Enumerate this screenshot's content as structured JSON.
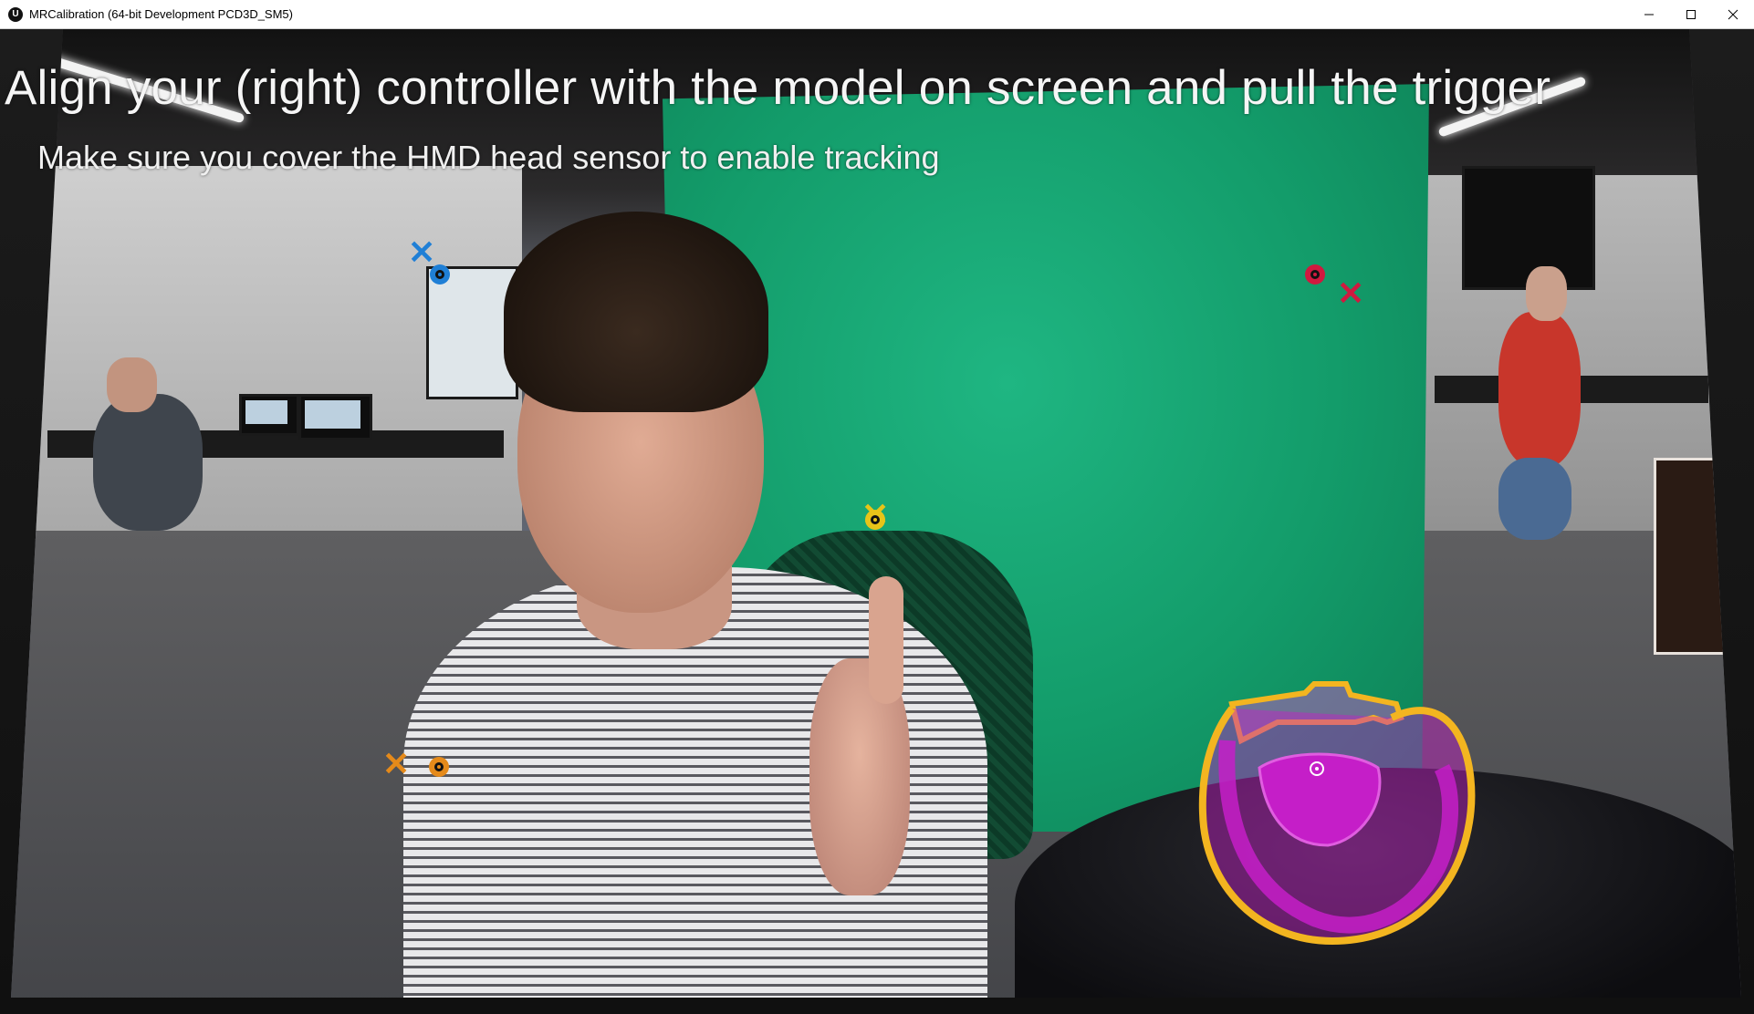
{
  "window": {
    "title": "MRCalibration (64-bit Development PCD3D_SM5)",
    "app_icon": "unreal-engine-icon",
    "buttons": [
      "minimize-icon",
      "maximize-icon",
      "close-icon"
    ]
  },
  "overlay": {
    "instruction": "Align your (right) controller with the model on screen and pull the trigger",
    "subinstruction": "Make sure you cover the HMD head sensor to enable tracking"
  },
  "markers": [
    {
      "name": "blue-cross",
      "color": "#1f7fd6"
    },
    {
      "name": "blue-target",
      "color": "#1f7fd6"
    },
    {
      "name": "red-target",
      "color": "#d0193f"
    },
    {
      "name": "red-cross",
      "color": "#d0193f"
    },
    {
      "name": "yellow-marker",
      "color": "#e8c419"
    },
    {
      "name": "orange-cross",
      "color": "#e58a1a"
    },
    {
      "name": "orange-target",
      "color": "#e58a1a"
    }
  ],
  "controller_model": {
    "fill": "#c51ec8",
    "outline": "#f3b520"
  }
}
